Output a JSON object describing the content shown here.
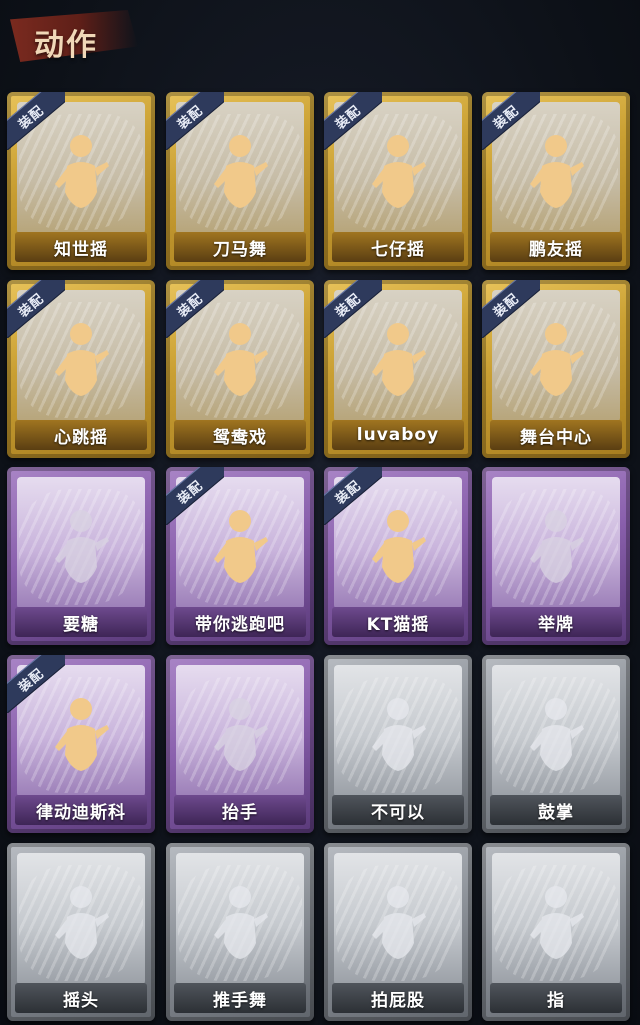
{
  "header": {
    "title": "动作"
  },
  "equip_label": "装配",
  "colors": {
    "gold": "#caa033",
    "purple": "#8a60ad",
    "grey": "#8e939a",
    "title_banner": "#7a2a1f"
  },
  "emotes": [
    {
      "label": "知世摇",
      "rarity": "gold",
      "equipped": true,
      "icon": "dancing-figure-icon"
    },
    {
      "label": "刀马舞",
      "rarity": "gold",
      "equipped": true,
      "icon": "dancing-figure-icon"
    },
    {
      "label": "七仔摇",
      "rarity": "gold",
      "equipped": true,
      "icon": "dancing-figure-icon"
    },
    {
      "label": "鹏友摇",
      "rarity": "gold",
      "equipped": true,
      "icon": "dancing-figure-icon"
    },
    {
      "label": "心跳摇",
      "rarity": "gold",
      "equipped": true,
      "icon": "dancing-figure-icon"
    },
    {
      "label": "鸳鸯戏",
      "rarity": "gold",
      "equipped": true,
      "icon": "dancing-figure-icon"
    },
    {
      "label": "luvaboy",
      "rarity": "gold",
      "equipped": true,
      "icon": "dancing-figure-icon"
    },
    {
      "label": "舞台中心",
      "rarity": "gold",
      "equipped": true,
      "icon": "dancing-figure-icon"
    },
    {
      "label": "要糖",
      "rarity": "purple",
      "equipped": false,
      "icon": "reaching-figure-icon"
    },
    {
      "label": "带你逃跑吧",
      "rarity": "purple",
      "equipped": true,
      "icon": "dancing-figure-icon"
    },
    {
      "label": "KT猫摇",
      "rarity": "purple",
      "equipped": true,
      "icon": "dancing-figure-icon"
    },
    {
      "label": "举牌",
      "rarity": "purple",
      "equipped": false,
      "icon": "holding-sign-icon"
    },
    {
      "label": "律动迪斯科",
      "rarity": "purple",
      "equipped": true,
      "icon": "disco-figure-icon"
    },
    {
      "label": "抬手",
      "rarity": "purple",
      "equipped": false,
      "icon": "raising-hand-icon"
    },
    {
      "label": "不可以",
      "rarity": "grey",
      "equipped": false,
      "icon": "finger-wag-icon"
    },
    {
      "label": "鼓掌",
      "rarity": "grey",
      "equipped": false,
      "icon": "clapping-hands-icon"
    },
    {
      "label": "摇头",
      "rarity": "grey",
      "equipped": false,
      "icon": "shaking-head-icon"
    },
    {
      "label": "推手舞",
      "rarity": "grey",
      "equipped": false,
      "icon": "pushing-hands-icon"
    },
    {
      "label": "拍屁股",
      "rarity": "grey",
      "equipped": false,
      "icon": "bending-figure-icon"
    },
    {
      "label": "指",
      "rarity": "grey",
      "equipped": false,
      "icon": "pointing-hand-icon"
    }
  ]
}
